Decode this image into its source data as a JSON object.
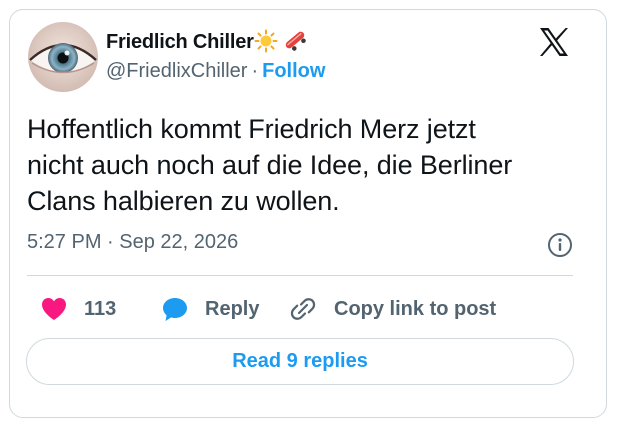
{
  "tweet": {
    "author": {
      "display_name": "Friedlich Chiller",
      "handle": "@FriedlixChiller",
      "follow_label": "Follow",
      "separator": "·",
      "name_icons": [
        "sun-icon",
        "skateboard-icon"
      ]
    },
    "text": "Hoffentlich kommt Friedrich Merz jetzt\nnicht auch noch auf die Idee, die Berliner\nClans halbieren zu wollen.",
    "timestamp": "5:27 PM · Sep 22, 2026",
    "like_count": "113",
    "reply_label": "Reply",
    "copy_link_label": "Copy link to post",
    "read_replies_label": "Read 9 replies"
  },
  "colors": {
    "accent": "#1d9bf0",
    "like": "#f91880",
    "text": "#0f1419",
    "muted": "#536471",
    "border": "#cfd9de"
  }
}
